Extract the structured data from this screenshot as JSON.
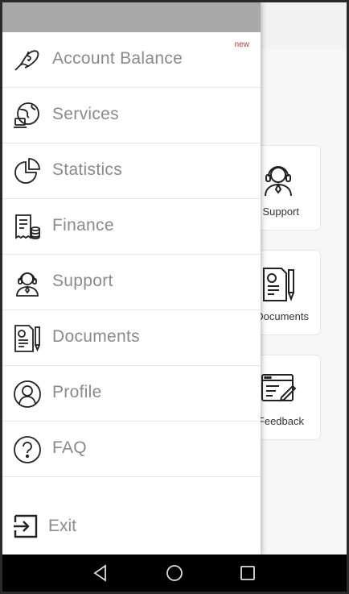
{
  "drawer": {
    "items": [
      {
        "label": "Account Balance",
        "icon": "money-hand-icon",
        "badge": "new"
      },
      {
        "label": "Services",
        "icon": "globe-laptop-icon"
      },
      {
        "label": "Statistics",
        "icon": "pie-chart-icon"
      },
      {
        "label": "Finance",
        "icon": "receipt-coins-icon"
      },
      {
        "label": "Support",
        "icon": "headset-agent-icon"
      },
      {
        "label": "Documents",
        "icon": "document-pen-icon"
      },
      {
        "label": "Profile",
        "icon": "user-circle-icon"
      },
      {
        "label": "FAQ",
        "icon": "question-circle-icon"
      }
    ],
    "exit": {
      "label": "Exit",
      "icon": "exit-icon"
    }
  },
  "background": {
    "cards": [
      {
        "label": "Support",
        "icon": "headset-agent-icon"
      },
      {
        "label": "Documents",
        "icon": "document-pen-icon"
      },
      {
        "label": "Feedback",
        "icon": "feedback-window-icon"
      }
    ]
  },
  "navbar": {
    "buttons": [
      "back-icon",
      "home-icon",
      "recent-apps-icon"
    ]
  },
  "colors": {
    "drawer_header": "#a9a9a9",
    "label": "#8a8a8a",
    "badge": "#c0392b",
    "navbar": "#000000"
  }
}
